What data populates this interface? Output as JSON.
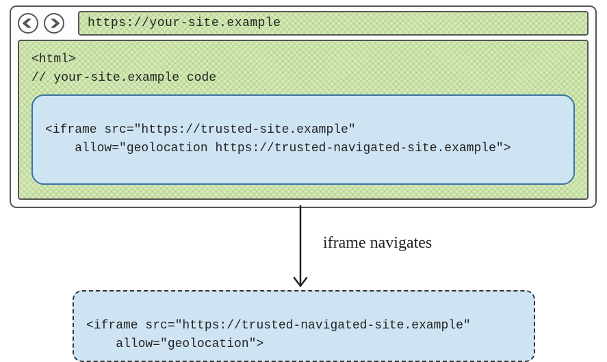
{
  "browser": {
    "back_icon": "back-icon",
    "forward_icon": "forward-icon",
    "address_url": "https://your-site.example"
  },
  "page_code": {
    "line1": "<html>",
    "line2": "// your-site.example code"
  },
  "iframe_original": {
    "line1": "<iframe src=\"https://trusted-site.example\"",
    "line2": "    allow=\"geolocation https://trusted-navigated-site.example\">"
  },
  "arrow_label": "iframe navigates",
  "iframe_navigated": {
    "line1": "<iframe src=\"https://trusted-navigated-site.example\"",
    "line2": "    allow=\"geolocation\">"
  }
}
